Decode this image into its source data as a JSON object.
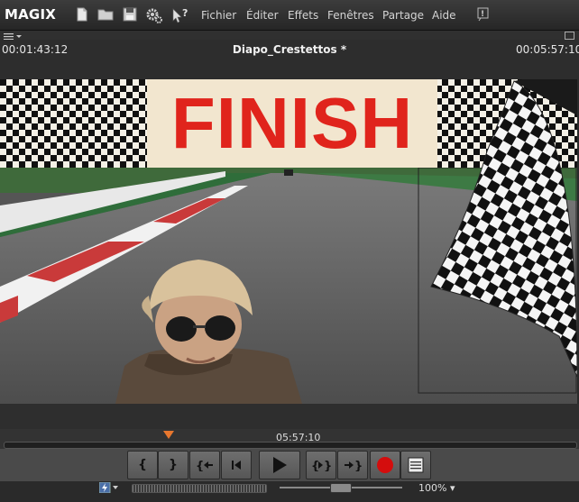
{
  "app": {
    "logo": "MAGIX"
  },
  "menu": [
    "Fichier",
    "Éditer",
    "Effets",
    "Fenêtres",
    "Partage",
    "Aide"
  ],
  "toolbar_icons": [
    "new-file-icon",
    "open-folder-icon",
    "save-icon",
    "settings-icon",
    "help-cursor-icon",
    "info-icon"
  ],
  "info": {
    "time_current": "00:01:43:12",
    "project_title": "Diapo_Crestettos *",
    "time_total": "00:05:57:10"
  },
  "preview": {
    "banner_text": "FINISH",
    "colors": {
      "banner_bg": "#f2e6cf",
      "banner_text": "#e0241c"
    }
  },
  "timeline": {
    "playhead_time": "05:57:10"
  },
  "transport": {
    "buttons": [
      "set-in",
      "set-out",
      "prev-marker",
      "go-start",
      "play",
      "next-marker-range",
      "go-end",
      "record",
      "menu"
    ],
    "labels": {
      "set_in": "{",
      "set_out": "}"
    }
  },
  "bottom": {
    "zoom": "100%"
  },
  "colors": {
    "accent": "#e8772e",
    "record": "#d40d0d"
  }
}
